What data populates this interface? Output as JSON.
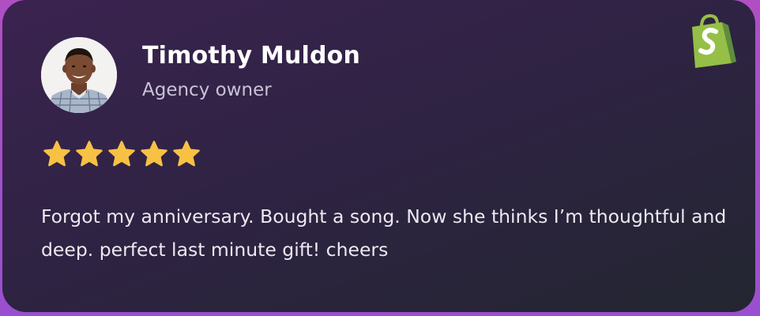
{
  "review": {
    "author_name": "Timothy Muldon",
    "author_role": "Agency owner",
    "rating": 5,
    "rating_max": 5,
    "text": "Forgot my anniversary. Bought a song. Now she thinks I’m thoughtful and deep. perfect last minute gift! cheers",
    "brand_icon": "shopify-bag-icon",
    "star_icon": "star-icon",
    "avatar_icon": "avatar"
  },
  "colors": {
    "star": "#f7c144",
    "brand_green": "#95bf47",
    "brand_dark_green": "#5e8e3e",
    "name": "#ffffff",
    "role": "#c9c2d6",
    "text": "#ece9f1"
  }
}
